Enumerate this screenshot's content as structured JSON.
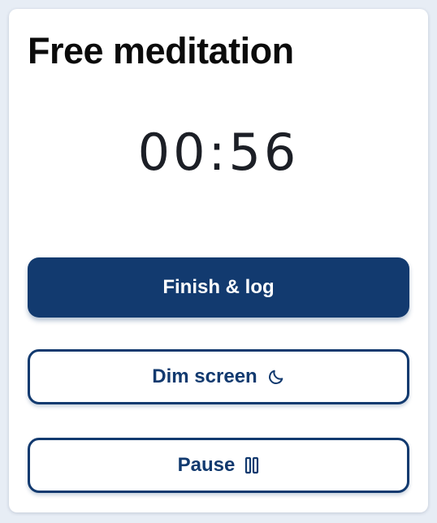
{
  "card": {
    "title": "Free meditation",
    "timer": "00:56"
  },
  "actions": {
    "finish_label": "Finish & log",
    "dim_label": "Dim screen",
    "dim_icon": "moon-icon",
    "pause_label": "Pause",
    "pause_icon": "pause-icon"
  },
  "colors": {
    "primary": "#123a6f",
    "background": "#e7edf5",
    "card": "#ffffff"
  }
}
